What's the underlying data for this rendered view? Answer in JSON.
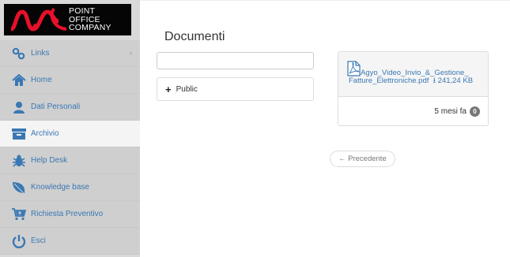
{
  "brand": {
    "logo_lines": [
      "POINT",
      "OFFICE",
      "COMPANY"
    ]
  },
  "sidebar": {
    "items": [
      {
        "label": "Links",
        "icon": "links-icon",
        "has_chevron": true,
        "chevron": "‹"
      },
      {
        "label": "Home",
        "icon": "home-icon"
      },
      {
        "label": "Dati Personali",
        "icon": "user-icon"
      },
      {
        "label": "Archivio",
        "icon": "archive-icon",
        "active": true
      },
      {
        "label": "Help Desk",
        "icon": "bug-icon"
      },
      {
        "label": "Knowledge base",
        "icon": "leaf-icon"
      },
      {
        "label": "Richiesta Preventivo",
        "icon": "cart-icon"
      },
      {
        "label": "Esci",
        "icon": "power-icon"
      }
    ],
    "icon_color": "#3a78b4",
    "active_bg": "#f4f4f4"
  },
  "main": {
    "title": "Documenti",
    "search": {
      "value": "",
      "placeholder": ""
    },
    "folders": [
      {
        "label": "Public",
        "icon": "plus-icon"
      }
    ],
    "files": [
      {
        "name_line1": "Agyo_Video_Invio_&_Gestione_",
        "name_line2": "Fatture_Elettroniche.pdf",
        "size": "241,24 KB",
        "age": "5 mesi fa",
        "count": "0",
        "icon": "pdf-file-icon"
      }
    ],
    "pager": {
      "previous_label": "← Precedente"
    }
  }
}
